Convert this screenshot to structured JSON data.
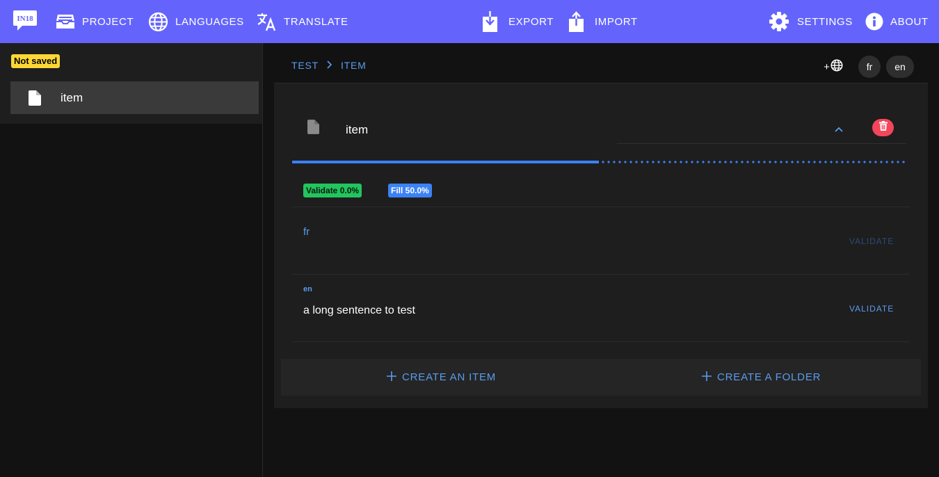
{
  "topbar": {
    "logo_text": "IN18",
    "project": "PROJECT",
    "languages": "LANGUAGES",
    "translate": "TRANSLATE",
    "export": "EXPORT",
    "import": "IMPORT",
    "settings": "SETTINGS",
    "about": "ABOUT"
  },
  "sidebar": {
    "status_badge": "Not saved",
    "items": [
      {
        "label": "item",
        "icon": "file-icon"
      }
    ]
  },
  "breadcrumb": {
    "root": "TEST",
    "current": "ITEM"
  },
  "languages": {
    "add_label": "+",
    "chips": [
      "fr",
      "en"
    ]
  },
  "item": {
    "title": "item",
    "progress_fill": 0.5,
    "stats": {
      "validate": "Validate 0.0%",
      "fill": "Fill 50.0%"
    },
    "translations": [
      {
        "lang": "fr",
        "value": "",
        "validate_label": "VALIDATE",
        "enabled": false
      },
      {
        "lang": "en",
        "value": "a long sentence to test",
        "validate_label": "VALIDATE",
        "enabled": true
      }
    ]
  },
  "actions": {
    "create_item": "CREATE AN ITEM",
    "create_folder": "CREATE A FOLDER"
  },
  "colors": {
    "accent": "#6464fc",
    "link": "#5a9cf0",
    "validate": "#22c55e",
    "fill": "#3b82f6",
    "danger": "#f4465a",
    "warning": "#fdd835"
  }
}
